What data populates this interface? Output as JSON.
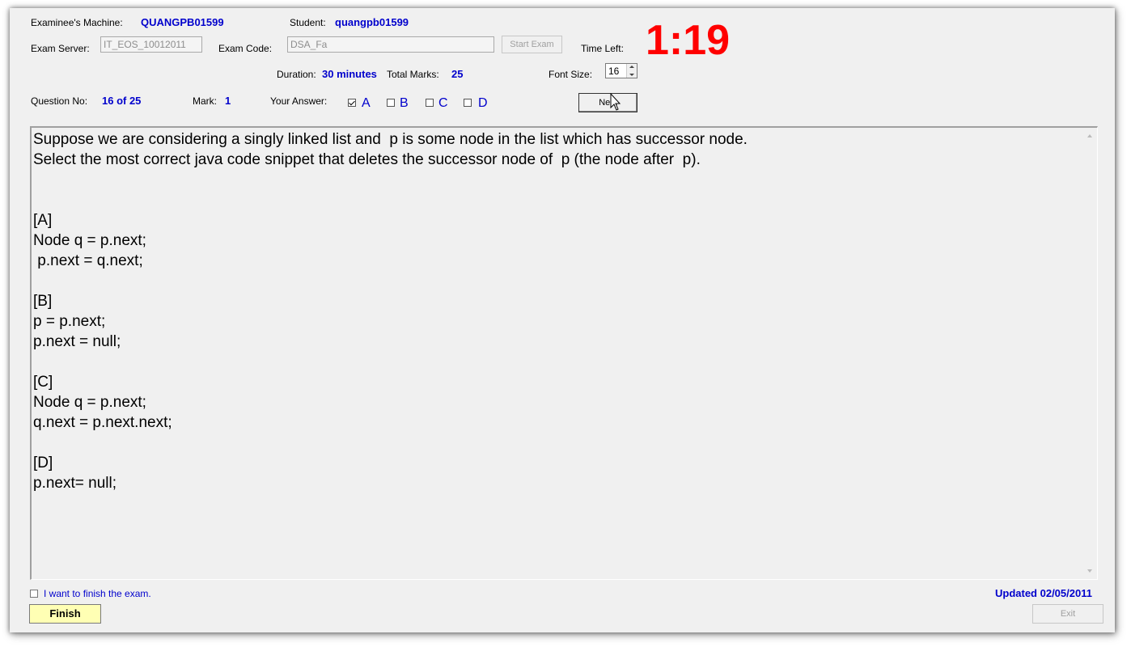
{
  "header": {
    "machine_label": "Examinee's Machine:",
    "machine_value": "QUANGPB01599",
    "student_label": "Student:",
    "student_value": "quangpb01599",
    "server_label": "Exam Server:",
    "server_value": "IT_EOS_10012011",
    "code_label": "Exam Code:",
    "code_value": "DSA_Fa",
    "start_exam_label": "Start Exam",
    "time_left_label": "Time Left:",
    "time_left_value": "1:19",
    "duration_label": "Duration:",
    "duration_value": "30 minutes",
    "total_marks_label": "Total Marks:",
    "total_marks_value": "25",
    "font_size_label": "Font Size:",
    "font_size_value": "16"
  },
  "question_bar": {
    "question_no_label": "Question No:",
    "question_no_value": "16 of 25",
    "mark_label": "Mark:",
    "mark_value": "1",
    "your_answer_label": "Your Answer:",
    "options": [
      {
        "label": "A",
        "checked": true
      },
      {
        "label": "B",
        "checked": false
      },
      {
        "label": "C",
        "checked": false
      },
      {
        "label": "D",
        "checked": false
      }
    ],
    "next_label": "Next"
  },
  "question": {
    "text": "Suppose we are considering a singly linked list and  p is some node in the list which has successor node.\nSelect the most correct java code snippet that deletes the successor node of  p (the node after  p).\n\n\n[A]\nNode q = p.next;\n p.next = q.next;\n\n[B]\np = p.next;\np.next = null;\n\n[C]\nNode q = p.next;\nq.next = p.next.next;\n\n[D]\np.next= null;"
  },
  "footer": {
    "finish_checkbox_label": "I want to finish the exam.",
    "finish_checked": false,
    "finish_button_label": "Finish",
    "updated_text": "Updated 02/05/2011",
    "exit_label": "Exit"
  },
  "colors": {
    "value_blue": "#0000cc",
    "timer_red": "#ff0000",
    "finish_yellow": "#ffffb4"
  }
}
